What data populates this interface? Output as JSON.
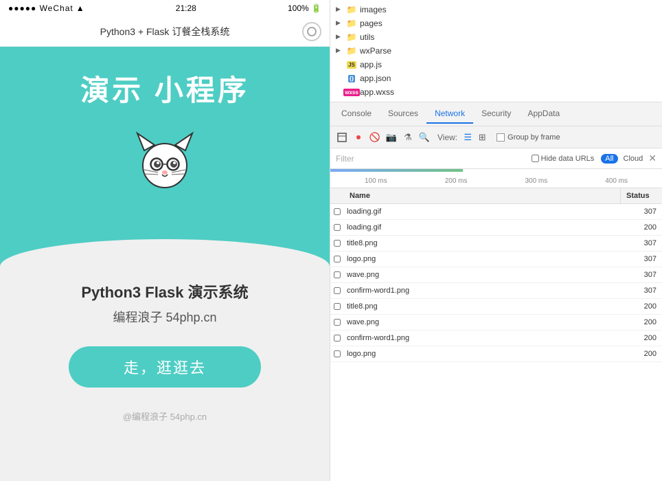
{
  "phone": {
    "status_bar": {
      "carrier": "●●●●● WeChat",
      "time": "21:28",
      "battery": "100%"
    },
    "title_bar": {
      "text": "Python3 + Flask 订餐全栈系统",
      "dot": "●"
    },
    "hero": {
      "title": "演示 小程序"
    },
    "content": {
      "app_name": "Python3 Flask 演示系统",
      "author": "编程浪子 54php.cn",
      "button": "走，逛逛去"
    },
    "footer": {
      "text": "@编程浪子 54php.cn"
    }
  },
  "devtools": {
    "file_tree": {
      "items": [
        {
          "type": "folder",
          "name": "images",
          "indent": 1
        },
        {
          "type": "folder",
          "name": "pages",
          "indent": 1
        },
        {
          "type": "folder",
          "name": "utils",
          "indent": 1
        },
        {
          "type": "folder",
          "name": "wxParse",
          "indent": 1
        },
        {
          "type": "js",
          "name": "app.js",
          "indent": 1
        },
        {
          "type": "json",
          "name": "app.json",
          "indent": 1
        },
        {
          "type": "wxss",
          "name": "app.wxss",
          "indent": 1
        }
      ]
    },
    "tabs": [
      {
        "label": "Console",
        "active": false
      },
      {
        "label": "Sources",
        "active": false
      },
      {
        "label": "Network",
        "active": true
      },
      {
        "label": "Security",
        "active": false
      },
      {
        "label": "AppData",
        "active": false
      }
    ],
    "toolbar": {
      "view_label": "View:",
      "group_by_frame_label": "Group by frame"
    },
    "filter": {
      "placeholder": "Filter",
      "hide_data_urls": "Hide data URLs",
      "all_label": "All",
      "cloud_label": "Cloud",
      "x_label": "✕"
    },
    "timeline": {
      "labels": [
        "100 ms",
        "200 ms",
        "300 ms",
        "400 ms"
      ]
    },
    "table": {
      "headers": [
        "Name",
        "Status"
      ],
      "rows": [
        {
          "name": "loading.gif",
          "status": "307"
        },
        {
          "name": "loading.gif",
          "status": "200"
        },
        {
          "name": "title8.png",
          "status": "307"
        },
        {
          "name": "logo.png",
          "status": "307"
        },
        {
          "name": "wave.png",
          "status": "307"
        },
        {
          "name": "confirm-word1.png",
          "status": "307"
        },
        {
          "name": "title8.png",
          "status": "200"
        },
        {
          "name": "wave.png",
          "status": "200"
        },
        {
          "name": "confirm-word1.png",
          "status": "200"
        },
        {
          "name": "logo.png",
          "status": "200"
        }
      ]
    }
  }
}
